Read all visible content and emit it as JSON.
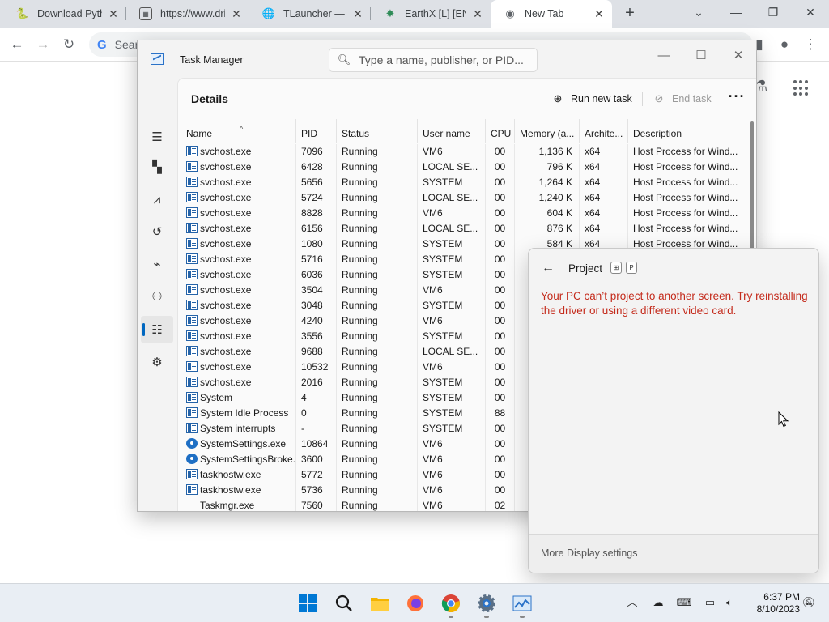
{
  "browser": {
    "tabs": [
      {
        "title": "Download Pytho",
        "icon": "python-icon"
      },
      {
        "title": "https://www.dri",
        "icon": "site-icon"
      },
      {
        "title": "TLauncher — Do",
        "icon": "globe-icon"
      },
      {
        "title": "EarthX [L] [ENG",
        "icon": "earthx-icon"
      },
      {
        "title": "New Tab",
        "icon": "chrome-icon"
      }
    ],
    "omnibox_placeholder": "Sear"
  },
  "task_manager": {
    "title": "Task Manager",
    "search_placeholder": "Type a name, publisher, or PID...",
    "page_title": "Details",
    "run_new_task": "Run new task",
    "end_task": "End task",
    "columns": [
      "Name",
      "PID",
      "Status",
      "User name",
      "CPU",
      "Memory (a...",
      "Archite...",
      "Description"
    ],
    "rows": [
      {
        "name": "svchost.exe",
        "icon": "service",
        "pid": "7096",
        "status": "Running",
        "user": "VM6",
        "cpu": "00",
        "mem": "1,136 K",
        "arch": "x64",
        "desc": "Host Process for Wind..."
      },
      {
        "name": "svchost.exe",
        "icon": "service",
        "pid": "6428",
        "status": "Running",
        "user": "LOCAL SE...",
        "cpu": "00",
        "mem": "796 K",
        "arch": "x64",
        "desc": "Host Process for Wind..."
      },
      {
        "name": "svchost.exe",
        "icon": "service",
        "pid": "5656",
        "status": "Running",
        "user": "SYSTEM",
        "cpu": "00",
        "mem": "1,264 K",
        "arch": "x64",
        "desc": "Host Process for Wind..."
      },
      {
        "name": "svchost.exe",
        "icon": "service",
        "pid": "5724",
        "status": "Running",
        "user": "LOCAL SE...",
        "cpu": "00",
        "mem": "1,240 K",
        "arch": "x64",
        "desc": "Host Process for Wind..."
      },
      {
        "name": "svchost.exe",
        "icon": "service",
        "pid": "8828",
        "status": "Running",
        "user": "VM6",
        "cpu": "00",
        "mem": "604 K",
        "arch": "x64",
        "desc": "Host Process for Wind..."
      },
      {
        "name": "svchost.exe",
        "icon": "service",
        "pid": "6156",
        "status": "Running",
        "user": "LOCAL SE...",
        "cpu": "00",
        "mem": "876 K",
        "arch": "x64",
        "desc": "Host Process for Wind..."
      },
      {
        "name": "svchost.exe",
        "icon": "service",
        "pid": "1080",
        "status": "Running",
        "user": "SYSTEM",
        "cpu": "00",
        "mem": "584 K",
        "arch": "x64",
        "desc": "Host Process for Wind..."
      },
      {
        "name": "svchost.exe",
        "icon": "service",
        "pid": "5716",
        "status": "Running",
        "user": "SYSTEM",
        "cpu": "00",
        "mem": "",
        "arch": "",
        "desc": ""
      },
      {
        "name": "svchost.exe",
        "icon": "service",
        "pid": "6036",
        "status": "Running",
        "user": "SYSTEM",
        "cpu": "00",
        "mem": "",
        "arch": "",
        "desc": ""
      },
      {
        "name": "svchost.exe",
        "icon": "service",
        "pid": "3504",
        "status": "Running",
        "user": "VM6",
        "cpu": "00",
        "mem": "",
        "arch": "",
        "desc": ""
      },
      {
        "name": "svchost.exe",
        "icon": "service",
        "pid": "3048",
        "status": "Running",
        "user": "SYSTEM",
        "cpu": "00",
        "mem": "",
        "arch": "",
        "desc": ""
      },
      {
        "name": "svchost.exe",
        "icon": "service",
        "pid": "4240",
        "status": "Running",
        "user": "VM6",
        "cpu": "00",
        "mem": "",
        "arch": "",
        "desc": ""
      },
      {
        "name": "svchost.exe",
        "icon": "service",
        "pid": "3556",
        "status": "Running",
        "user": "SYSTEM",
        "cpu": "00",
        "mem": "",
        "arch": "",
        "desc": ""
      },
      {
        "name": "svchost.exe",
        "icon": "service",
        "pid": "9688",
        "status": "Running",
        "user": "LOCAL SE...",
        "cpu": "00",
        "mem": "",
        "arch": "",
        "desc": ""
      },
      {
        "name": "svchost.exe",
        "icon": "service",
        "pid": "10532",
        "status": "Running",
        "user": "VM6",
        "cpu": "00",
        "mem": "",
        "arch": "",
        "desc": ""
      },
      {
        "name": "svchost.exe",
        "icon": "service",
        "pid": "2016",
        "status": "Running",
        "user": "SYSTEM",
        "cpu": "00",
        "mem": "",
        "arch": "",
        "desc": ""
      },
      {
        "name": "System",
        "icon": "service",
        "pid": "4",
        "status": "Running",
        "user": "SYSTEM",
        "cpu": "00",
        "mem": "",
        "arch": "",
        "desc": ""
      },
      {
        "name": "System Idle Process",
        "icon": "service",
        "pid": "0",
        "status": "Running",
        "user": "SYSTEM",
        "cpu": "88",
        "mem": "",
        "arch": "",
        "desc": ""
      },
      {
        "name": "System interrupts",
        "icon": "service",
        "pid": "-",
        "status": "Running",
        "user": "SYSTEM",
        "cpu": "00",
        "mem": "",
        "arch": "",
        "desc": ""
      },
      {
        "name": "SystemSettings.exe",
        "icon": "gear",
        "pid": "10864",
        "status": "Running",
        "user": "VM6",
        "cpu": "00",
        "mem": "",
        "arch": "",
        "desc": ""
      },
      {
        "name": "SystemSettingsBroke...",
        "icon": "gear",
        "pid": "3600",
        "status": "Running",
        "user": "VM6",
        "cpu": "00",
        "mem": "",
        "arch": "",
        "desc": ""
      },
      {
        "name": "taskhostw.exe",
        "icon": "service",
        "pid": "5772",
        "status": "Running",
        "user": "VM6",
        "cpu": "00",
        "mem": "",
        "arch": "",
        "desc": ""
      },
      {
        "name": "taskhostw.exe",
        "icon": "service",
        "pid": "5736",
        "status": "Running",
        "user": "VM6",
        "cpu": "00",
        "mem": "",
        "arch": "",
        "desc": ""
      },
      {
        "name": "Taskmgr.exe",
        "icon": "taskmgr",
        "pid": "7560",
        "status": "Running",
        "user": "VM6",
        "cpu": "02",
        "mem": "",
        "arch": "",
        "desc": ""
      }
    ]
  },
  "project": {
    "title": "Project",
    "key1": "⊞",
    "key2": "P",
    "message": "Your PC can’t project to another screen. Try reinstalling the driver or using a different video card.",
    "footer_link": "More Display settings"
  },
  "taskbar": {
    "time": "6:37 PM",
    "date": "8/10/2023"
  },
  "colors": {
    "accent": "#0067c0",
    "error": "#c42b1c"
  }
}
